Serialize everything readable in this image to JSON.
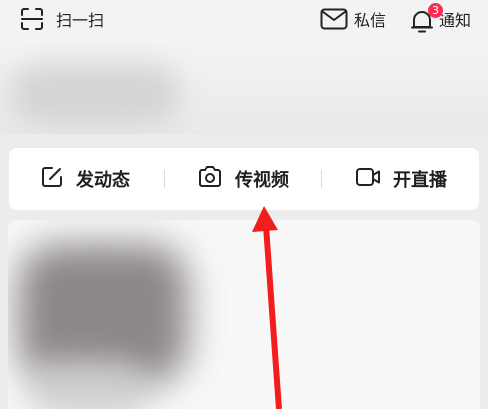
{
  "header": {
    "scan_label": "扫一扫",
    "message_label": "私信",
    "notify_label": "通知",
    "notify_count": "3"
  },
  "actions": {
    "post_label": "发动态",
    "video_label": "传视频",
    "live_label": "开直播"
  },
  "icons": {
    "scan": "scan-icon",
    "message": "envelope-icon",
    "notify": "bell-icon",
    "post": "edit-icon",
    "video": "camera-icon",
    "live": "video-camera-icon"
  },
  "colors": {
    "badge": "#fe2c55",
    "annotation_arrow": "#f21d1d"
  }
}
